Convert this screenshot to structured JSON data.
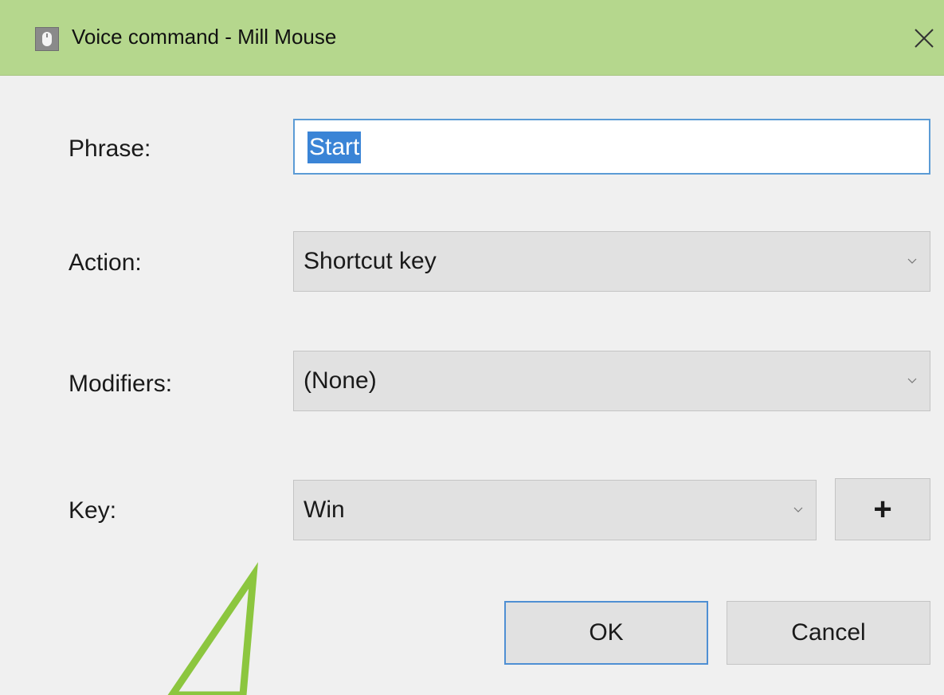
{
  "window": {
    "title": "Voice command - Mill Mouse",
    "titlebar_color": "#b5d78d",
    "accent_color": "#3a84d6",
    "icons": {
      "app": "mouse-icon",
      "close": "close-icon",
      "dropdown": "chevron-down-icon",
      "add": "plus-icon"
    }
  },
  "form": {
    "phrase": {
      "label": "Phrase:",
      "value": "Start"
    },
    "action": {
      "label": "Action:",
      "value": "Shortcut key"
    },
    "modifiers": {
      "label": "Modifiers:",
      "value": "(None)"
    },
    "key": {
      "label": "Key:",
      "value": "Win",
      "add_label": "+"
    }
  },
  "buttons": {
    "ok": "OK",
    "cancel": "Cancel"
  },
  "annotation": {
    "callout_color": "#8cc63f"
  }
}
